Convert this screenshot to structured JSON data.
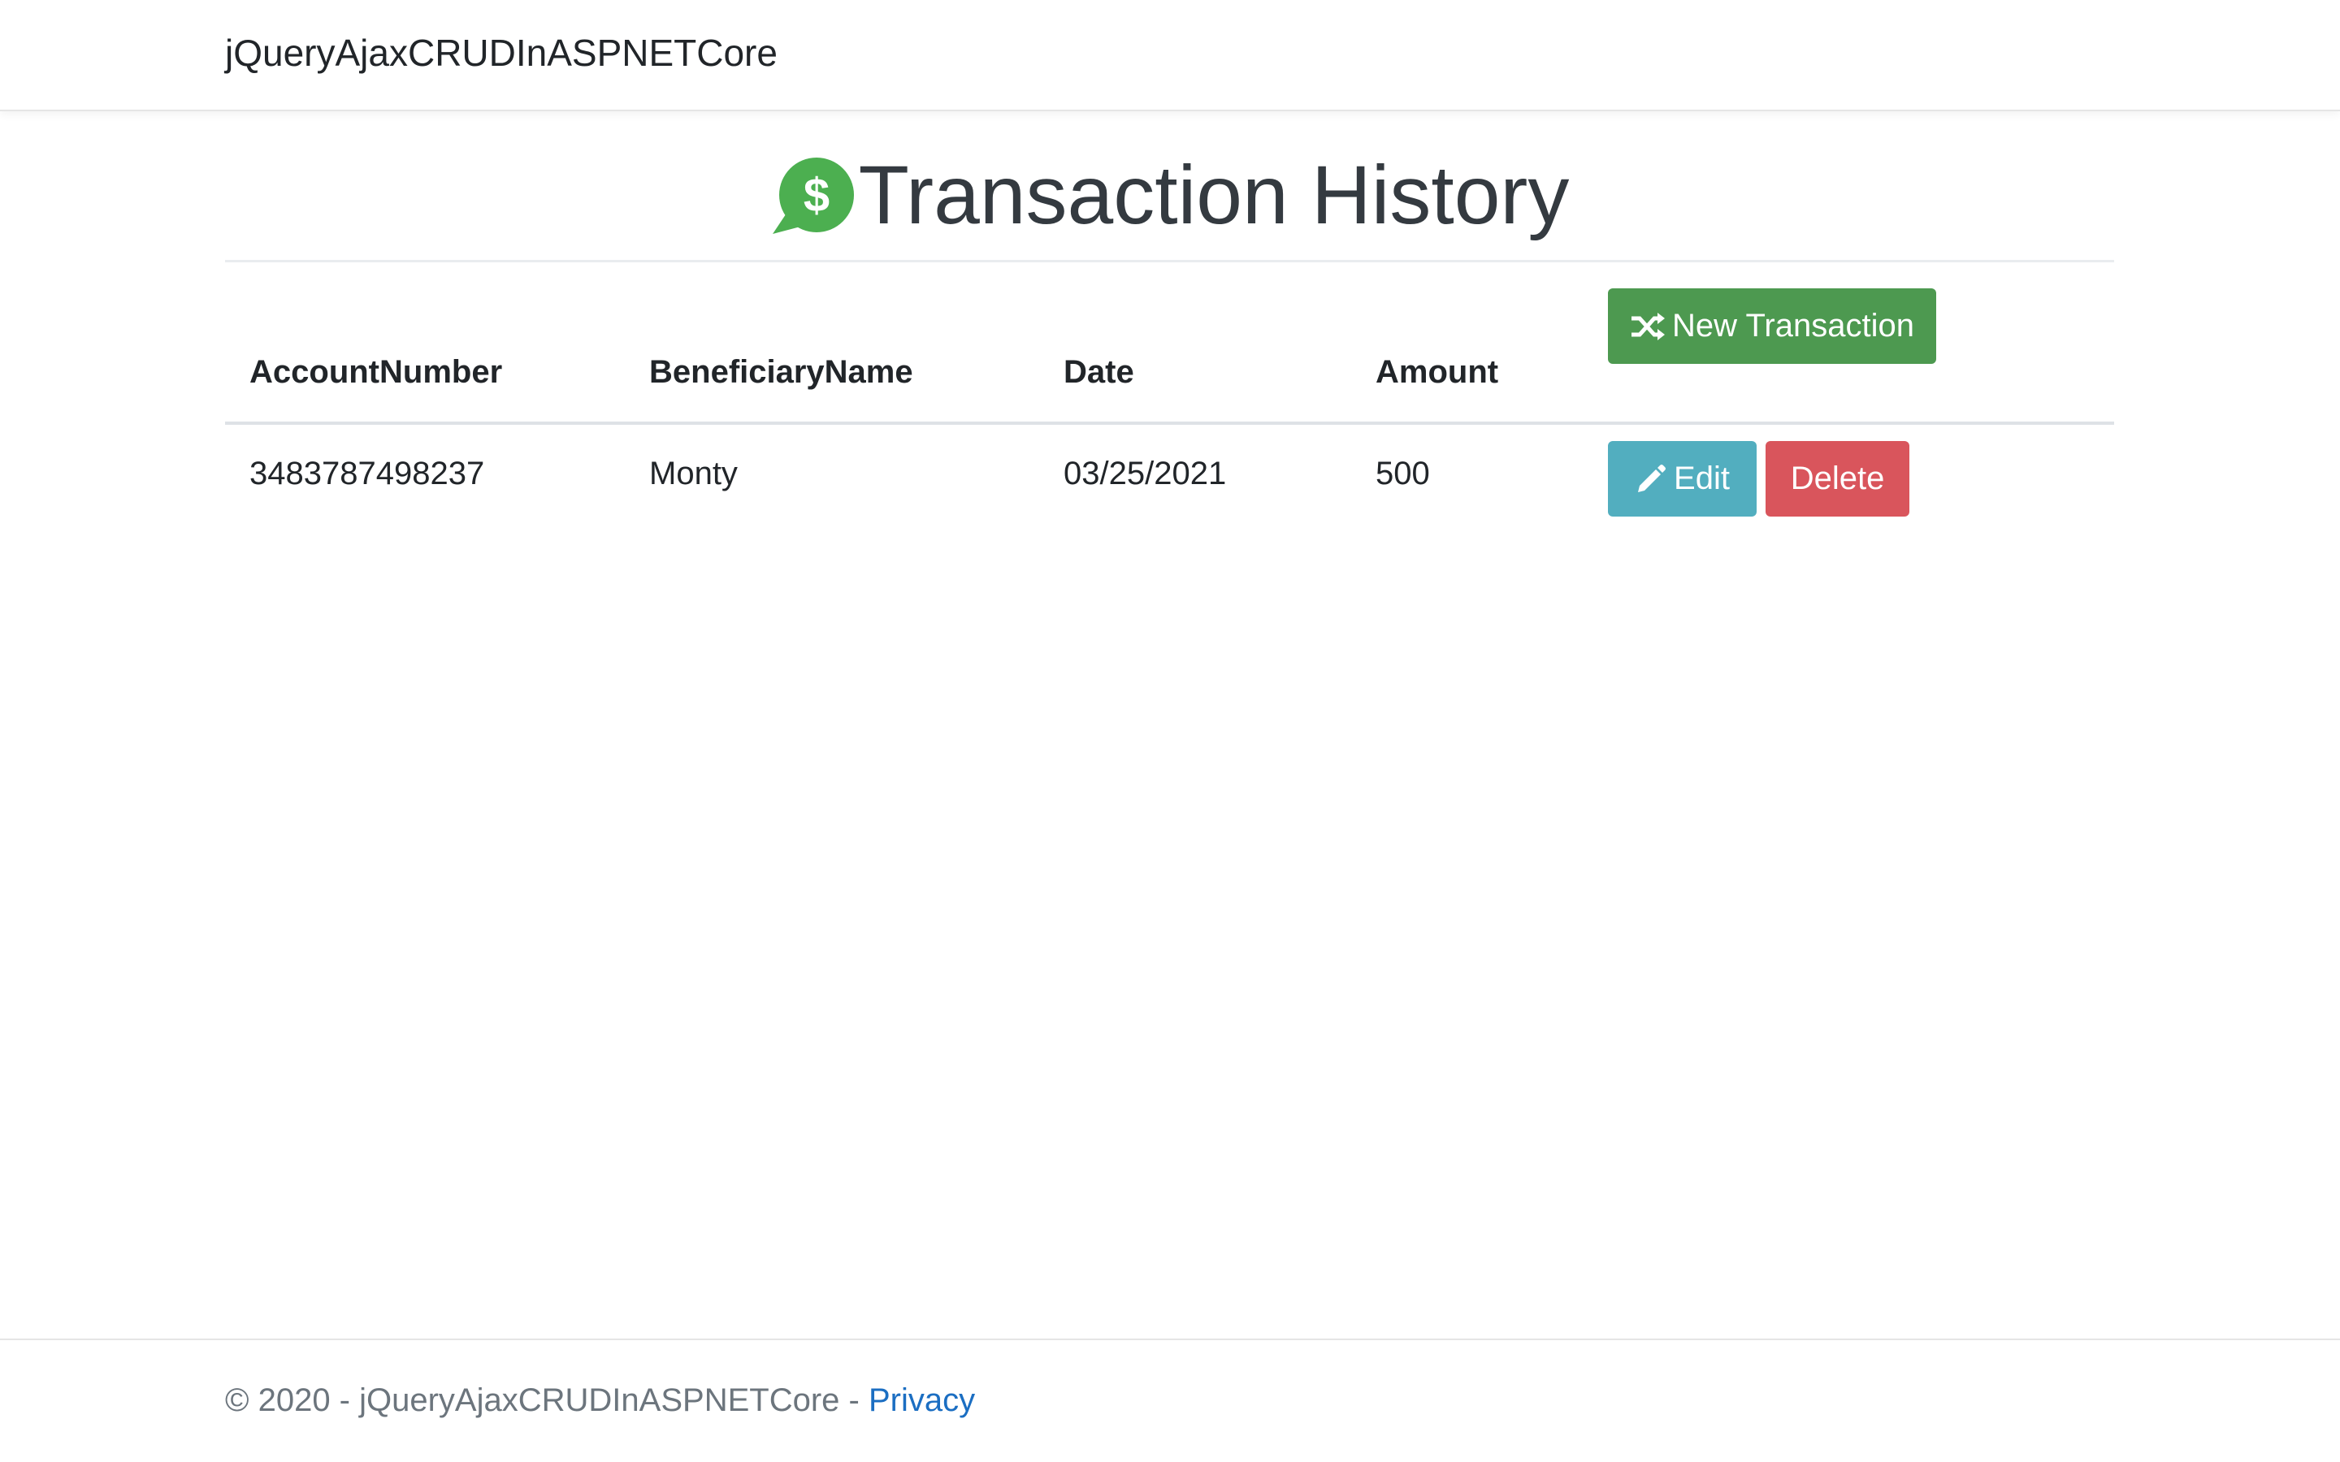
{
  "navbar": {
    "brand": "jQueryAjaxCRUDInASPNETCore"
  },
  "page": {
    "title": "Transaction History",
    "title_icon": "dollar-speech-bubble-icon",
    "accent_color": "#4caf50"
  },
  "table": {
    "headers": {
      "account_number": "AccountNumber",
      "beneficiary_name": "BeneficiaryName",
      "date": "Date",
      "amount": "Amount"
    },
    "new_button_label": "New Transaction",
    "rows": [
      {
        "account_number": "3483787498237",
        "beneficiary_name": "Monty",
        "date": "03/25/2021",
        "amount": "500",
        "edit_label": "Edit",
        "delete_label": "Delete"
      }
    ]
  },
  "footer": {
    "copyright": "© 2020 - jQueryAjaxCRUDInASPNETCore - ",
    "privacy_link": "Privacy"
  },
  "colors": {
    "new_button": "#4d9950",
    "edit_button": "#52aebf",
    "delete_button": "#d9555c",
    "link": "#1b6ec2"
  }
}
